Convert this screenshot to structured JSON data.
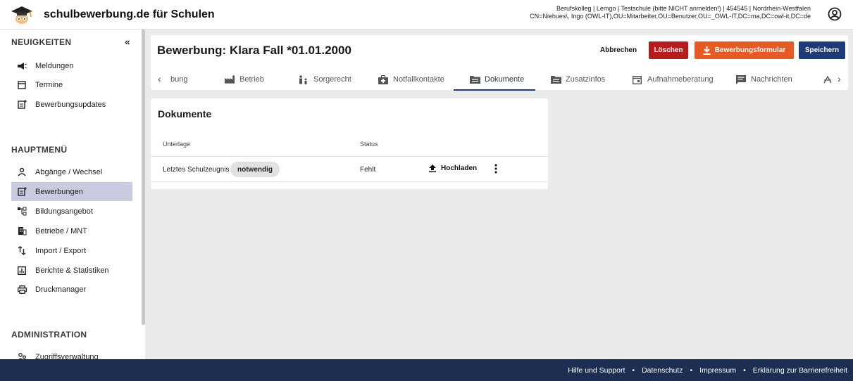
{
  "app": {
    "brand": "schulbewerbung.de für Schulen",
    "user_line1": "Berufskolleg | Lemgo | Testschule (bitte NICHT anmelden!) | 454545 | Nordrhein-Westfalen",
    "user_line2": "CN=Niehues\\, Ingo (OWL-IT),OU=Mitarbeiter,OU=Benutzer,OU=_OWL-IT,DC=ma,DC=owl-it,DC=de"
  },
  "sidebar": {
    "collapse_label": "«",
    "sections": {
      "news": "NEUIGKEITEN",
      "main": "HAUPTMENÜ",
      "admin": "ADMINISTRATION"
    },
    "news_items": [
      {
        "label": "Meldungen",
        "icon": "megaphone-icon"
      },
      {
        "label": "Termine",
        "icon": "calendar-icon"
      },
      {
        "label": "Bewerbungsupdates",
        "icon": "post-add-icon"
      }
    ],
    "main_items": [
      {
        "label": "Abgänge / Wechsel",
        "icon": "person-icon"
      },
      {
        "label": "Bewerbungen",
        "icon": "post-add-icon",
        "active": true
      },
      {
        "label": "Bildungsangebot",
        "icon": "schema-icon"
      },
      {
        "label": "Betriebe / MNT",
        "icon": "building-icon"
      },
      {
        "label": "Import / Export",
        "icon": "import-export-icon"
      },
      {
        "label": "Berichte & Statistiken",
        "icon": "chart-icon"
      },
      {
        "label": "Druckmanager",
        "icon": "printer-icon"
      }
    ],
    "admin_items": [
      {
        "label": "Zugriffsverwaltung",
        "icon": "people-icon"
      }
    ]
  },
  "header": {
    "title": "Bewerbung: Klara Fall *01.01.2000",
    "cancel": "Abbrechen",
    "delete": "Löschen",
    "form": "Bewerbungsformular",
    "save": "Speichern"
  },
  "tabs": [
    {
      "label": "bung",
      "icon": ""
    },
    {
      "label": "Betrieb",
      "icon": "factory-icon"
    },
    {
      "label": "Sorgerecht",
      "icon": "family-icon"
    },
    {
      "label": "Notfallkontakte",
      "icon": "medical-bag-icon"
    },
    {
      "label": "Dokumente",
      "icon": "folder-icon",
      "active": true
    },
    {
      "label": "Zusatzinfos",
      "icon": "folder-icon"
    },
    {
      "label": "Aufnahmeberatung",
      "icon": "calendar-event-icon"
    },
    {
      "label": "Nachrichten",
      "icon": "message-icon"
    }
  ],
  "documents": {
    "title": "Dokumente",
    "col_document": "Unterlage",
    "col_status": "Status",
    "rows": [
      {
        "name": "Letztes Schulzeugnis",
        "tag": "notwendig",
        "status": "Fehlt",
        "action": "Hochladen"
      }
    ]
  },
  "footer": {
    "help": "Hilfe und Support",
    "privacy": "Datenschutz",
    "imprint": "Impressum",
    "accessibility": "Erklärung zur Barrierefreiheit",
    "separator": "•"
  },
  "colors": {
    "primary": "#1e3a78",
    "danger": "#b71c1c",
    "accent": "#e65a25",
    "footer": "#1c2f52",
    "active_nav": "#c9cbe0"
  }
}
